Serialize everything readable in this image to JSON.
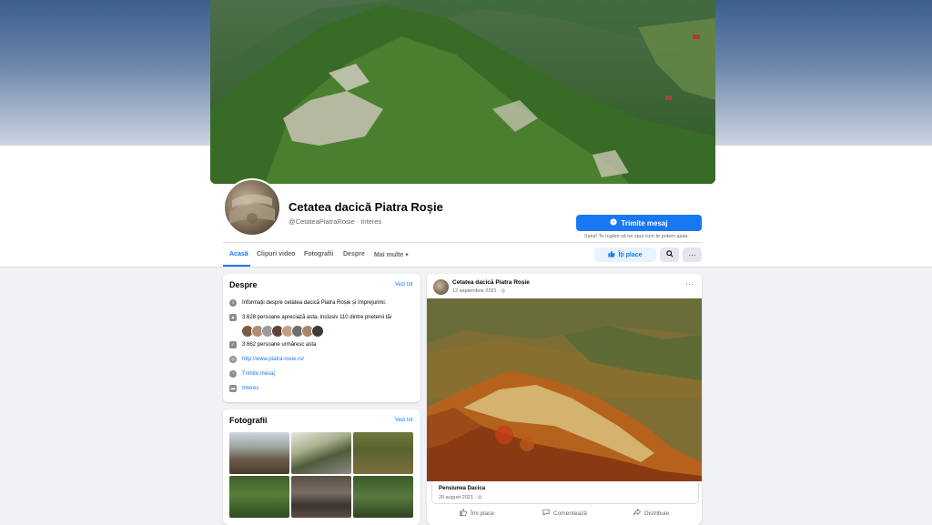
{
  "page": {
    "title": "Cetatea dacică Piatra Roșie",
    "subtitle": "@CetateaPiatraRosie · Interes",
    "send_message_label": "Trimite mesaj",
    "send_message_note": "Salut! Te rugăm să ne spui cum te putem ajuta."
  },
  "tabs": [
    {
      "label": "Acasă",
      "active": true
    },
    {
      "label": "Clipuri video"
    },
    {
      "label": "Fotografii"
    },
    {
      "label": "Despre"
    },
    {
      "label": "Mai multe ▾"
    }
  ],
  "actions": {
    "like_label": "Îți place",
    "search_icon": "search-icon",
    "more_icon": "more-icon"
  },
  "about": {
    "title": "Despre",
    "see_all": "Vezi tot",
    "description": "Informații despre cetatea dacică Piatra Roșie și împrejurimi.",
    "likes": "3.628 persoane apreciază asta, inclusiv 110 dintre prietenii tăi",
    "followers": "3.662 persoane urmăresc asta",
    "website": "http://www.piatra-rosie.ro/",
    "message": "Trimite mesaj",
    "category": "Interes"
  },
  "photos": {
    "title": "Fotografii",
    "see_all": "Vezi tot"
  },
  "post": {
    "author": "Cetatea dacică Piatra Roșie",
    "date": "12 septembrie 2021 · ",
    "more": "···",
    "attachment_name": "Pensiunea Dacica",
    "attachment_date": "20 august 2021 · ",
    "like": "Îmi place",
    "comment": "Comentează",
    "share": "Distribuie"
  },
  "colors": {
    "accent": "#1877f2",
    "background": "#f0f2f5",
    "secondary_text": "#65676b"
  }
}
